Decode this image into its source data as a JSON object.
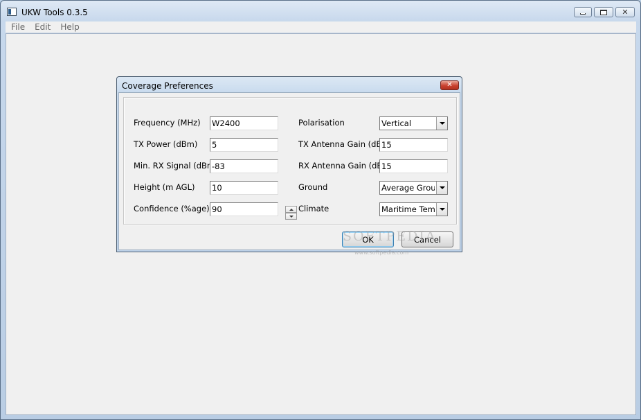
{
  "window": {
    "title": "UKW Tools 0.3.5",
    "controls": {
      "minimize_icon": "minimize-icon",
      "maximize_icon": "maximize-icon",
      "close_icon": "close-icon"
    }
  },
  "menu": [
    "File",
    "Edit",
    "Help"
  ],
  "dialog": {
    "title": "Coverage Preferences",
    "left_fields": [
      {
        "label": "Frequency (MHz)",
        "value": "W2400"
      },
      {
        "label": "TX Power (dBm)",
        "value": "5"
      },
      {
        "label": "Min. RX Signal (dBm)",
        "value": "-83"
      },
      {
        "label": "Height (m AGL)",
        "value": "10"
      },
      {
        "label": "Confidence (%age)",
        "value": "90"
      }
    ],
    "right_fields": [
      {
        "label": "Polarisation",
        "value": "Vertical",
        "type": "combo"
      },
      {
        "label": "TX Antenna Gain (dBi)",
        "value": "15",
        "type": "text"
      },
      {
        "label": "RX Antenna Gain (dBi)",
        "value": "15",
        "type": "text"
      },
      {
        "label": "Ground",
        "value": "Average Ground",
        "type": "combo"
      },
      {
        "label": "Climate",
        "value": "Maritime Temperate",
        "type": "combo"
      }
    ],
    "buttons": {
      "ok": "OK",
      "cancel": "Cancel"
    },
    "watermark": {
      "text": "SOFTPEDIA",
      "url": "www.softpedia.com"
    }
  },
  "colors": {
    "titlebar": "#c7d8ec",
    "client_bg": "#f0f0f0",
    "dialog_close": "#c9412f",
    "default_button_border": "#3c7fb1"
  }
}
